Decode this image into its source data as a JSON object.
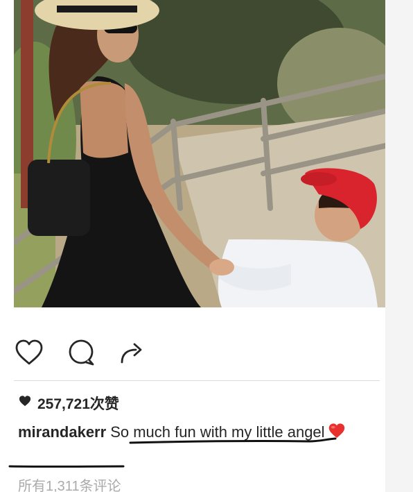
{
  "post": {
    "likes_count": "257,721次赞",
    "caption_user": "mirandakerr",
    "caption_text": "So much fun with my little angel",
    "comments_link": "所有1,311条评论"
  },
  "icons": {
    "like": "heart-outline-icon",
    "comment": "speech-bubble-icon",
    "share": "share-arrow-icon",
    "likes_marker": "heart-filled-icon",
    "caption_emoji": "red-heart-emoji"
  },
  "colors": {
    "text": "#262626",
    "muted": "#aaaaaa",
    "divider": "#dbdbdb",
    "annotation": "#111111",
    "heart_emoji": "#e8312f",
    "cap": "#d9232d"
  }
}
